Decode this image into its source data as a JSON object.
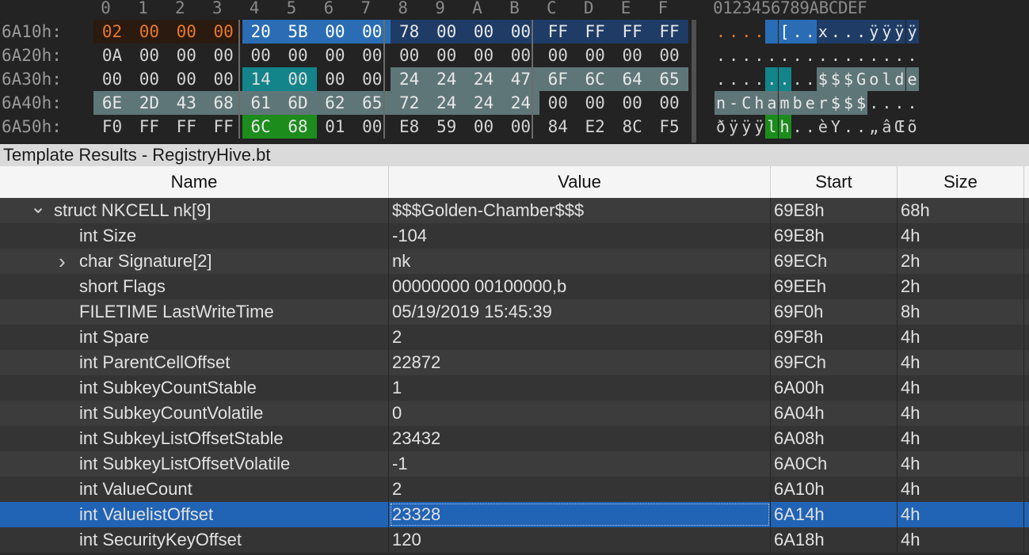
{
  "hex": {
    "column_headers": [
      "0",
      "1",
      "2",
      "3",
      "4",
      "5",
      "6",
      "7",
      "8",
      "9",
      "A",
      "B",
      "C",
      "D",
      "E",
      "F"
    ],
    "ascii_header": "0123456789ABCDEF",
    "rows": [
      {
        "addr": "6A10h:",
        "bytes": [
          "02",
          "00",
          "00",
          "00",
          "20",
          "5B",
          "00",
          "00",
          "78",
          "00",
          "00",
          "00",
          "FF",
          "FF",
          "FF",
          "FF"
        ],
        "ascii": [
          ".",
          ".",
          ".",
          ".",
          " ",
          "[",
          ".",
          ".",
          "x",
          ".",
          ".",
          ".",
          "ÿ",
          "ÿ",
          "ÿ",
          "ÿ"
        ]
      },
      {
        "addr": "6A20h:",
        "bytes": [
          "0A",
          "00",
          "00",
          "00",
          "00",
          "00",
          "00",
          "00",
          "00",
          "00",
          "00",
          "00",
          "00",
          "00",
          "00",
          "00"
        ],
        "ascii": [
          ".",
          ".",
          ".",
          ".",
          ".",
          ".",
          ".",
          ".",
          ".",
          ".",
          ".",
          ".",
          ".",
          ".",
          ".",
          "."
        ]
      },
      {
        "addr": "6A30h:",
        "bytes": [
          "00",
          "00",
          "00",
          "00",
          "14",
          "00",
          "00",
          "00",
          "24",
          "24",
          "24",
          "47",
          "6F",
          "6C",
          "64",
          "65"
        ],
        "ascii": [
          ".",
          ".",
          ".",
          ".",
          ".",
          ".",
          ".",
          ".",
          "$",
          "$",
          "$",
          "G",
          "o",
          "l",
          "d",
          "e"
        ]
      },
      {
        "addr": "6A40h:",
        "bytes": [
          "6E",
          "2D",
          "43",
          "68",
          "61",
          "6D",
          "62",
          "65",
          "72",
          "24",
          "24",
          "24",
          "00",
          "00",
          "00",
          "00"
        ],
        "ascii": [
          "n",
          "-",
          "C",
          "h",
          "a",
          "m",
          "b",
          "e",
          "r",
          "$",
          "$",
          "$",
          ".",
          ".",
          ".",
          "."
        ]
      },
      {
        "addr": "6A50h:",
        "bytes": [
          "F0",
          "FF",
          "FF",
          "FF",
          "6C",
          "68",
          "01",
          "00",
          "E8",
          "59",
          "00",
          "00",
          "84",
          "E2",
          "8C",
          "F5"
        ],
        "ascii": [
          "ð",
          "ÿ",
          "ÿ",
          "ÿ",
          "l",
          "h",
          ".",
          ".",
          "è",
          "Y",
          ".",
          ".",
          "„",
          "â",
          "Œ",
          "õ"
        ]
      }
    ],
    "colors": {
      "orange_text": "#e8792a",
      "selection": "#2a6db5",
      "teal": "#13848a",
      "grey_highlight": "#5f7678",
      "green": "#1c8c1c"
    }
  },
  "template": {
    "title": "Template Results - RegistryHive.bt",
    "columns": [
      "Name",
      "Value",
      "Start",
      "Size"
    ],
    "rows": [
      {
        "name": "struct NKCELL nk[9]",
        "value": "$$$Golden-Chamber$$$",
        "start": "69E8h",
        "size": "68h",
        "arrow": "expanded"
      },
      {
        "name": "int Size",
        "value": "-104",
        "start": "69E8h",
        "size": "4h"
      },
      {
        "name": "char Signature[2]",
        "value": "nk",
        "start": "69ECh",
        "size": "2h",
        "arrow": "collapsed"
      },
      {
        "name": "short Flags",
        "value": "00000000 00100000,b",
        "start": "69EEh",
        "size": "2h"
      },
      {
        "name": "FILETIME LastWriteTime",
        "value": "05/19/2019 15:45:39",
        "start": "69F0h",
        "size": "8h"
      },
      {
        "name": "int Spare",
        "value": "2",
        "start": "69F8h",
        "size": "4h"
      },
      {
        "name": "int ParentCellOffset",
        "value": "22872",
        "start": "69FCh",
        "size": "4h"
      },
      {
        "name": "int SubkeyCountStable",
        "value": "1",
        "start": "6A00h",
        "size": "4h"
      },
      {
        "name": "int SubkeyCountVolatile",
        "value": "0",
        "start": "6A04h",
        "size": "4h"
      },
      {
        "name": "int SubkeyListOffsetStable",
        "value": "23432",
        "start": "6A08h",
        "size": "4h"
      },
      {
        "name": "int SubkeyListOffsetVolatile",
        "value": "-1",
        "start": "6A0Ch",
        "size": "4h"
      },
      {
        "name": "int ValueCount",
        "value": "2",
        "start": "6A10h",
        "size": "4h"
      },
      {
        "name": "int ValuelistOffset",
        "value": "23328",
        "start": "6A14h",
        "size": "4h",
        "selected": true
      },
      {
        "name": "int SecurityKeyOffset",
        "value": "120",
        "start": "6A18h",
        "size": "4h"
      }
    ]
  }
}
